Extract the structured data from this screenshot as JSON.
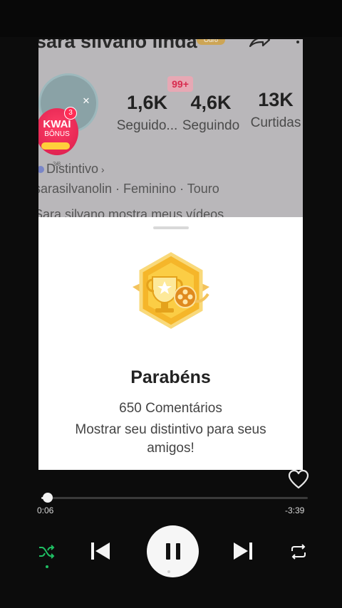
{
  "profile": {
    "name": "sara silvano linda",
    "name_badge": "Ouro",
    "notif_badge": "99+",
    "stats": [
      {
        "value": "1,6K",
        "label": "Seguido..."
      },
      {
        "value": "4,6K",
        "label": "Seguindo"
      },
      {
        "value": "13K",
        "label": "Curtidas"
      }
    ],
    "distintivo": "Distintivo",
    "info": "sarasilvanolin · Feminino · Touro",
    "bio": "Sara silvano mostra meus vídeos",
    "kwai_title": "KWAI",
    "kwai_sub": "BÔNUS",
    "kwai_count": "3",
    "kwai_caption": "3/8"
  },
  "sheet": {
    "title": "Parabéns",
    "subtitle": "650 Comentários",
    "description": "Mostrar seu distintivo para seus amigos!"
  },
  "player": {
    "current_time": "0:06",
    "remaining_time": "-3:39",
    "progress_fraction": 0.025
  },
  "icons": {
    "share": "share-icon",
    "more": "more-icon",
    "heart": "heart-icon",
    "shuffle": "shuffle-icon",
    "prev": "skip-previous-icon",
    "pause": "pause-icon",
    "next": "skip-next-icon",
    "repeat": "repeat-icon"
  },
  "colors": {
    "accent_green": "#1fbf63",
    "badge_red": "#d82b4e",
    "trophy_gold": "#f0b428"
  }
}
